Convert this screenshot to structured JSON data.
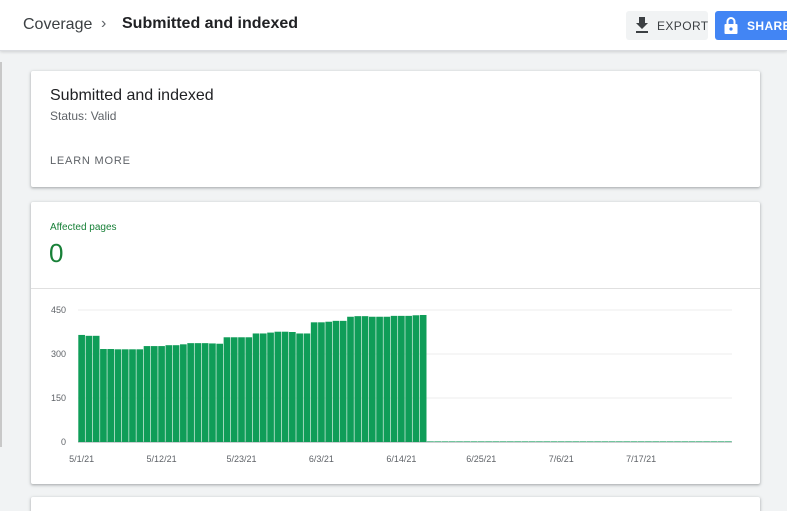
{
  "header": {
    "breadcrumb_root": "Coverage",
    "breadcrumb_separator": "›",
    "title": "Submitted and indexed",
    "export_label": "EXPORT",
    "share_label": "SHARE",
    "export_icon": "download-icon",
    "share_icon": "lock-icon"
  },
  "details_card": {
    "title": "Submitted and indexed",
    "status": "Status: Valid",
    "learn_more": "LEARN MORE"
  },
  "affected_card": {
    "label": "Affected pages",
    "value": "0"
  },
  "colors": {
    "accent_green": "#0f9d58",
    "label_green": "#188038",
    "share_blue": "#4285f4"
  },
  "chart_data": {
    "type": "bar",
    "ylim": [
      0,
      450
    ],
    "y_ticks": [
      "450",
      "300",
      "150",
      "0"
    ],
    "x_tick_labels": [
      "5/1/21",
      "5/12/21",
      "5/23/21",
      "6/3/21",
      "6/14/21",
      "6/25/21",
      "7/6/21",
      "7/17/21"
    ],
    "categories": [
      "5/1/21",
      "5/2/21",
      "5/3/21",
      "5/4/21",
      "5/5/21",
      "5/6/21",
      "5/7/21",
      "5/8/21",
      "5/9/21",
      "5/10/21",
      "5/11/21",
      "5/12/21",
      "5/13/21",
      "5/14/21",
      "5/15/21",
      "5/16/21",
      "5/17/21",
      "5/18/21",
      "5/19/21",
      "5/20/21",
      "5/21/21",
      "5/22/21",
      "5/23/21",
      "5/24/21",
      "5/25/21",
      "5/26/21",
      "5/27/21",
      "5/28/21",
      "5/29/21",
      "5/30/21",
      "5/31/21",
      "6/1/21",
      "6/2/21",
      "6/3/21",
      "6/4/21",
      "6/5/21",
      "6/6/21",
      "6/7/21",
      "6/8/21",
      "6/9/21",
      "6/10/21",
      "6/11/21",
      "6/12/21",
      "6/13/21",
      "6/14/21",
      "6/15/21",
      "6/16/21",
      "6/17/21",
      "6/18/21",
      "6/19/21",
      "6/20/21",
      "6/21/21",
      "6/22/21",
      "6/23/21",
      "6/24/21",
      "6/25/21",
      "6/26/21",
      "6/27/21",
      "6/28/21",
      "6/29/21",
      "6/30/21",
      "7/1/21",
      "7/2/21",
      "7/3/21",
      "7/4/21",
      "7/5/21",
      "7/6/21",
      "7/7/21",
      "7/8/21",
      "7/9/21",
      "7/10/21",
      "7/11/21",
      "7/12/21",
      "7/13/21",
      "7/14/21",
      "7/15/21",
      "7/16/21",
      "7/17/21",
      "7/18/21",
      "7/19/21",
      "7/20/21",
      "7/21/21",
      "7/22/21",
      "7/23/21",
      "7/24/21",
      "7/25/21",
      "7/26/21",
      "7/27/21",
      "7/28/21",
      "7/29/21"
    ],
    "values": [
      365,
      362,
      362,
      317,
      317,
      316,
      316,
      316,
      316,
      327,
      327,
      327,
      330,
      330,
      333,
      337,
      337,
      337,
      336,
      335,
      357,
      357,
      357,
      357,
      370,
      370,
      373,
      376,
      376,
      375,
      370,
      370,
      408,
      408,
      410,
      413,
      413,
      427,
      429,
      429,
      427,
      427,
      427,
      430,
      430,
      430,
      432,
      433,
      2,
      2,
      2,
      2,
      2,
      2,
      2,
      2,
      2,
      2,
      2,
      2,
      2,
      2,
      2,
      2,
      2,
      2,
      2,
      2,
      2,
      2,
      2,
      2,
      2,
      2,
      2,
      2,
      2,
      2,
      2,
      2,
      2,
      2,
      2,
      2,
      2,
      2,
      2,
      2,
      2,
      2
    ]
  }
}
